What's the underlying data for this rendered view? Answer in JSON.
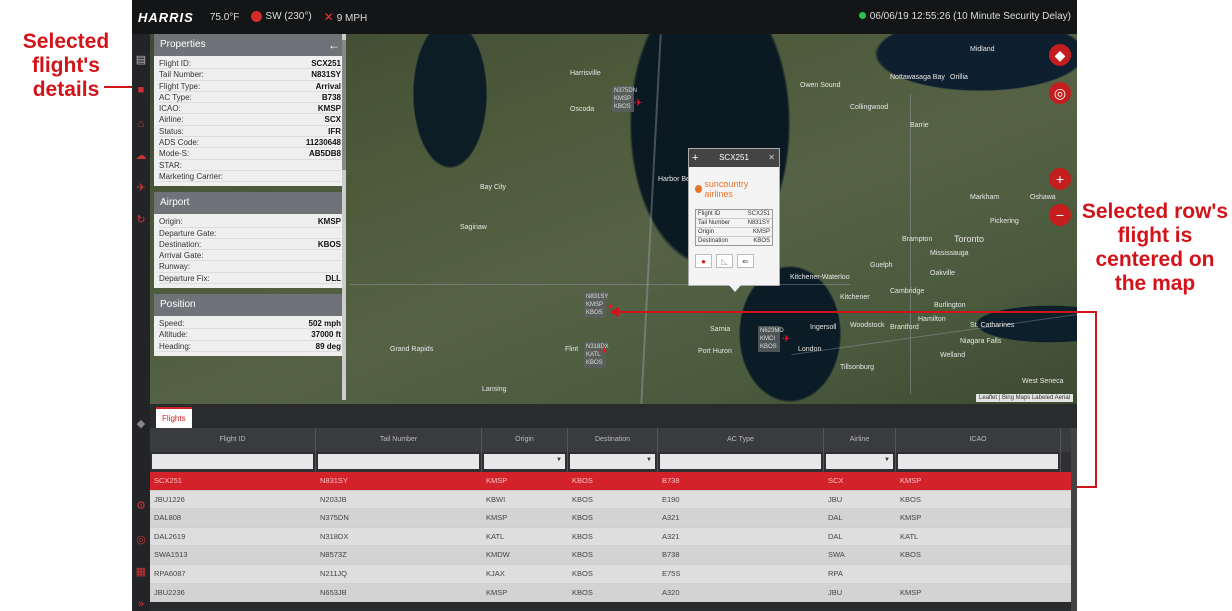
{
  "annotations": {
    "left": "Selected flight's details",
    "right": "Selected row's flight is centered on the map"
  },
  "topbar": {
    "logo": "HARRIS",
    "temperature": "75.0°F",
    "wind_dir": "SW (230°)",
    "wind_speed": "9 MPH",
    "clock": "06/06/19 12:55:26 (10 Minute Security Delay)",
    "status_color": "#27c24c"
  },
  "properties": {
    "title": "Properties",
    "fields": [
      {
        "k": "Flight ID:",
        "v": "SCX251"
      },
      {
        "k": "Tail Number:",
        "v": "N831SY"
      },
      {
        "k": "Flight Type:",
        "v": "Arrival"
      },
      {
        "k": "AC Type:",
        "v": "B738"
      },
      {
        "k": "ICAO:",
        "v": "KMSP"
      },
      {
        "k": "Airline:",
        "v": "SCX"
      },
      {
        "k": "Status:",
        "v": "IFR"
      },
      {
        "k": "ADS Code:",
        "v": "11230648"
      },
      {
        "k": "Mode-S:",
        "v": "AB5DB8"
      },
      {
        "k": "STAR:",
        "v": ""
      },
      {
        "k": "Marketing Carrier:",
        "v": ""
      }
    ],
    "airport_title": "Airport",
    "airport": [
      {
        "k": "Origin:",
        "v": "KMSP"
      },
      {
        "k": "Departure Gate:",
        "v": ""
      },
      {
        "k": "Destination:",
        "v": "KBOS"
      },
      {
        "k": "Arrival Gate:",
        "v": ""
      },
      {
        "k": "Runway:",
        "v": ""
      },
      {
        "k": "Departure Fix:",
        "v": "DLL"
      }
    ],
    "position_title": "Position",
    "position": [
      {
        "k": "Speed:",
        "v": "502 mph"
      },
      {
        "k": "Altitude:",
        "v": "37000 ft"
      },
      {
        "k": "Heading:",
        "v": "89 deg"
      }
    ]
  },
  "popup": {
    "title": "SCX251",
    "airline_logo_text": "suncountry airlines",
    "rows": [
      {
        "k": "Flight ID",
        "v": "SCX251"
      },
      {
        "k": "Tail Number",
        "v": "N831SY"
      },
      {
        "k": "Origin",
        "v": "KMSP"
      },
      {
        "k": "Destination",
        "v": "KBOS"
      }
    ]
  },
  "map": {
    "labels": [
      "Harrisville",
      "Oscoda",
      "Bay City",
      "Saginaw",
      "Flint",
      "Lansing",
      "Grand Rapids",
      "Harbor Beach",
      "Port Huron",
      "London",
      "Kitchener",
      "Guelph",
      "Toronto",
      "Mississauga",
      "Oakville",
      "Hamilton",
      "Barrie",
      "Orillia",
      "Brampton",
      "Woodstock",
      "Sarnia",
      "Ingersoll",
      "St. Catharines",
      "Welland",
      "Niagara Falls",
      "Tillsonburg",
      "Midland",
      "Nottawasaga Bay",
      "Owen Sound",
      "Collingwood",
      "Markham",
      "Pickering",
      "Oshawa",
      "Cambridge",
      "Brantford",
      "Burlington",
      "Kitchener-Waterloo",
      "West Seneca"
    ],
    "flight_tags": [
      {
        "text": "N375DN KMSP KBOS"
      },
      {
        "text": "N831SY KMSP KBOS"
      },
      {
        "text": "N318DX KATL KBOS"
      },
      {
        "text": "N623MD KMCI KBOS"
      }
    ],
    "scale_text": "Leaflet | Bing Maps Labeled Aerial",
    "accent": "#c41d1d"
  },
  "table": {
    "tab": "Flights",
    "columns": [
      "Flight ID",
      "Tail Number",
      "Origin",
      "Destination",
      "AC Type",
      "Airline",
      "ICAO"
    ],
    "rows": [
      [
        "SCX251",
        "N831SY",
        "KMSP",
        "KBOS",
        "B738",
        "SCX",
        "KMSP"
      ],
      [
        "JBU1226",
        "N203JB",
        "KBWI",
        "KBOS",
        "E190",
        "JBU",
        "KBOS"
      ],
      [
        "DAL808",
        "N375DN",
        "KMSP",
        "KBOS",
        "A321",
        "DAL",
        "KMSP"
      ],
      [
        "DAL2619",
        "N318DX",
        "KATL",
        "KBOS",
        "A321",
        "DAL",
        "KATL"
      ],
      [
        "SWA1513",
        "N8573Z",
        "KMDW",
        "KBOS",
        "B738",
        "SWA",
        "KBOS"
      ],
      [
        "RPA6087",
        "N211JQ",
        "KJAX",
        "KBOS",
        "E75S",
        "RPA",
        ""
      ],
      [
        "JBU2236",
        "N653JB",
        "KMSP",
        "KBOS",
        "A320",
        "JBU",
        "KMSP"
      ]
    ],
    "selected_index": 0
  }
}
